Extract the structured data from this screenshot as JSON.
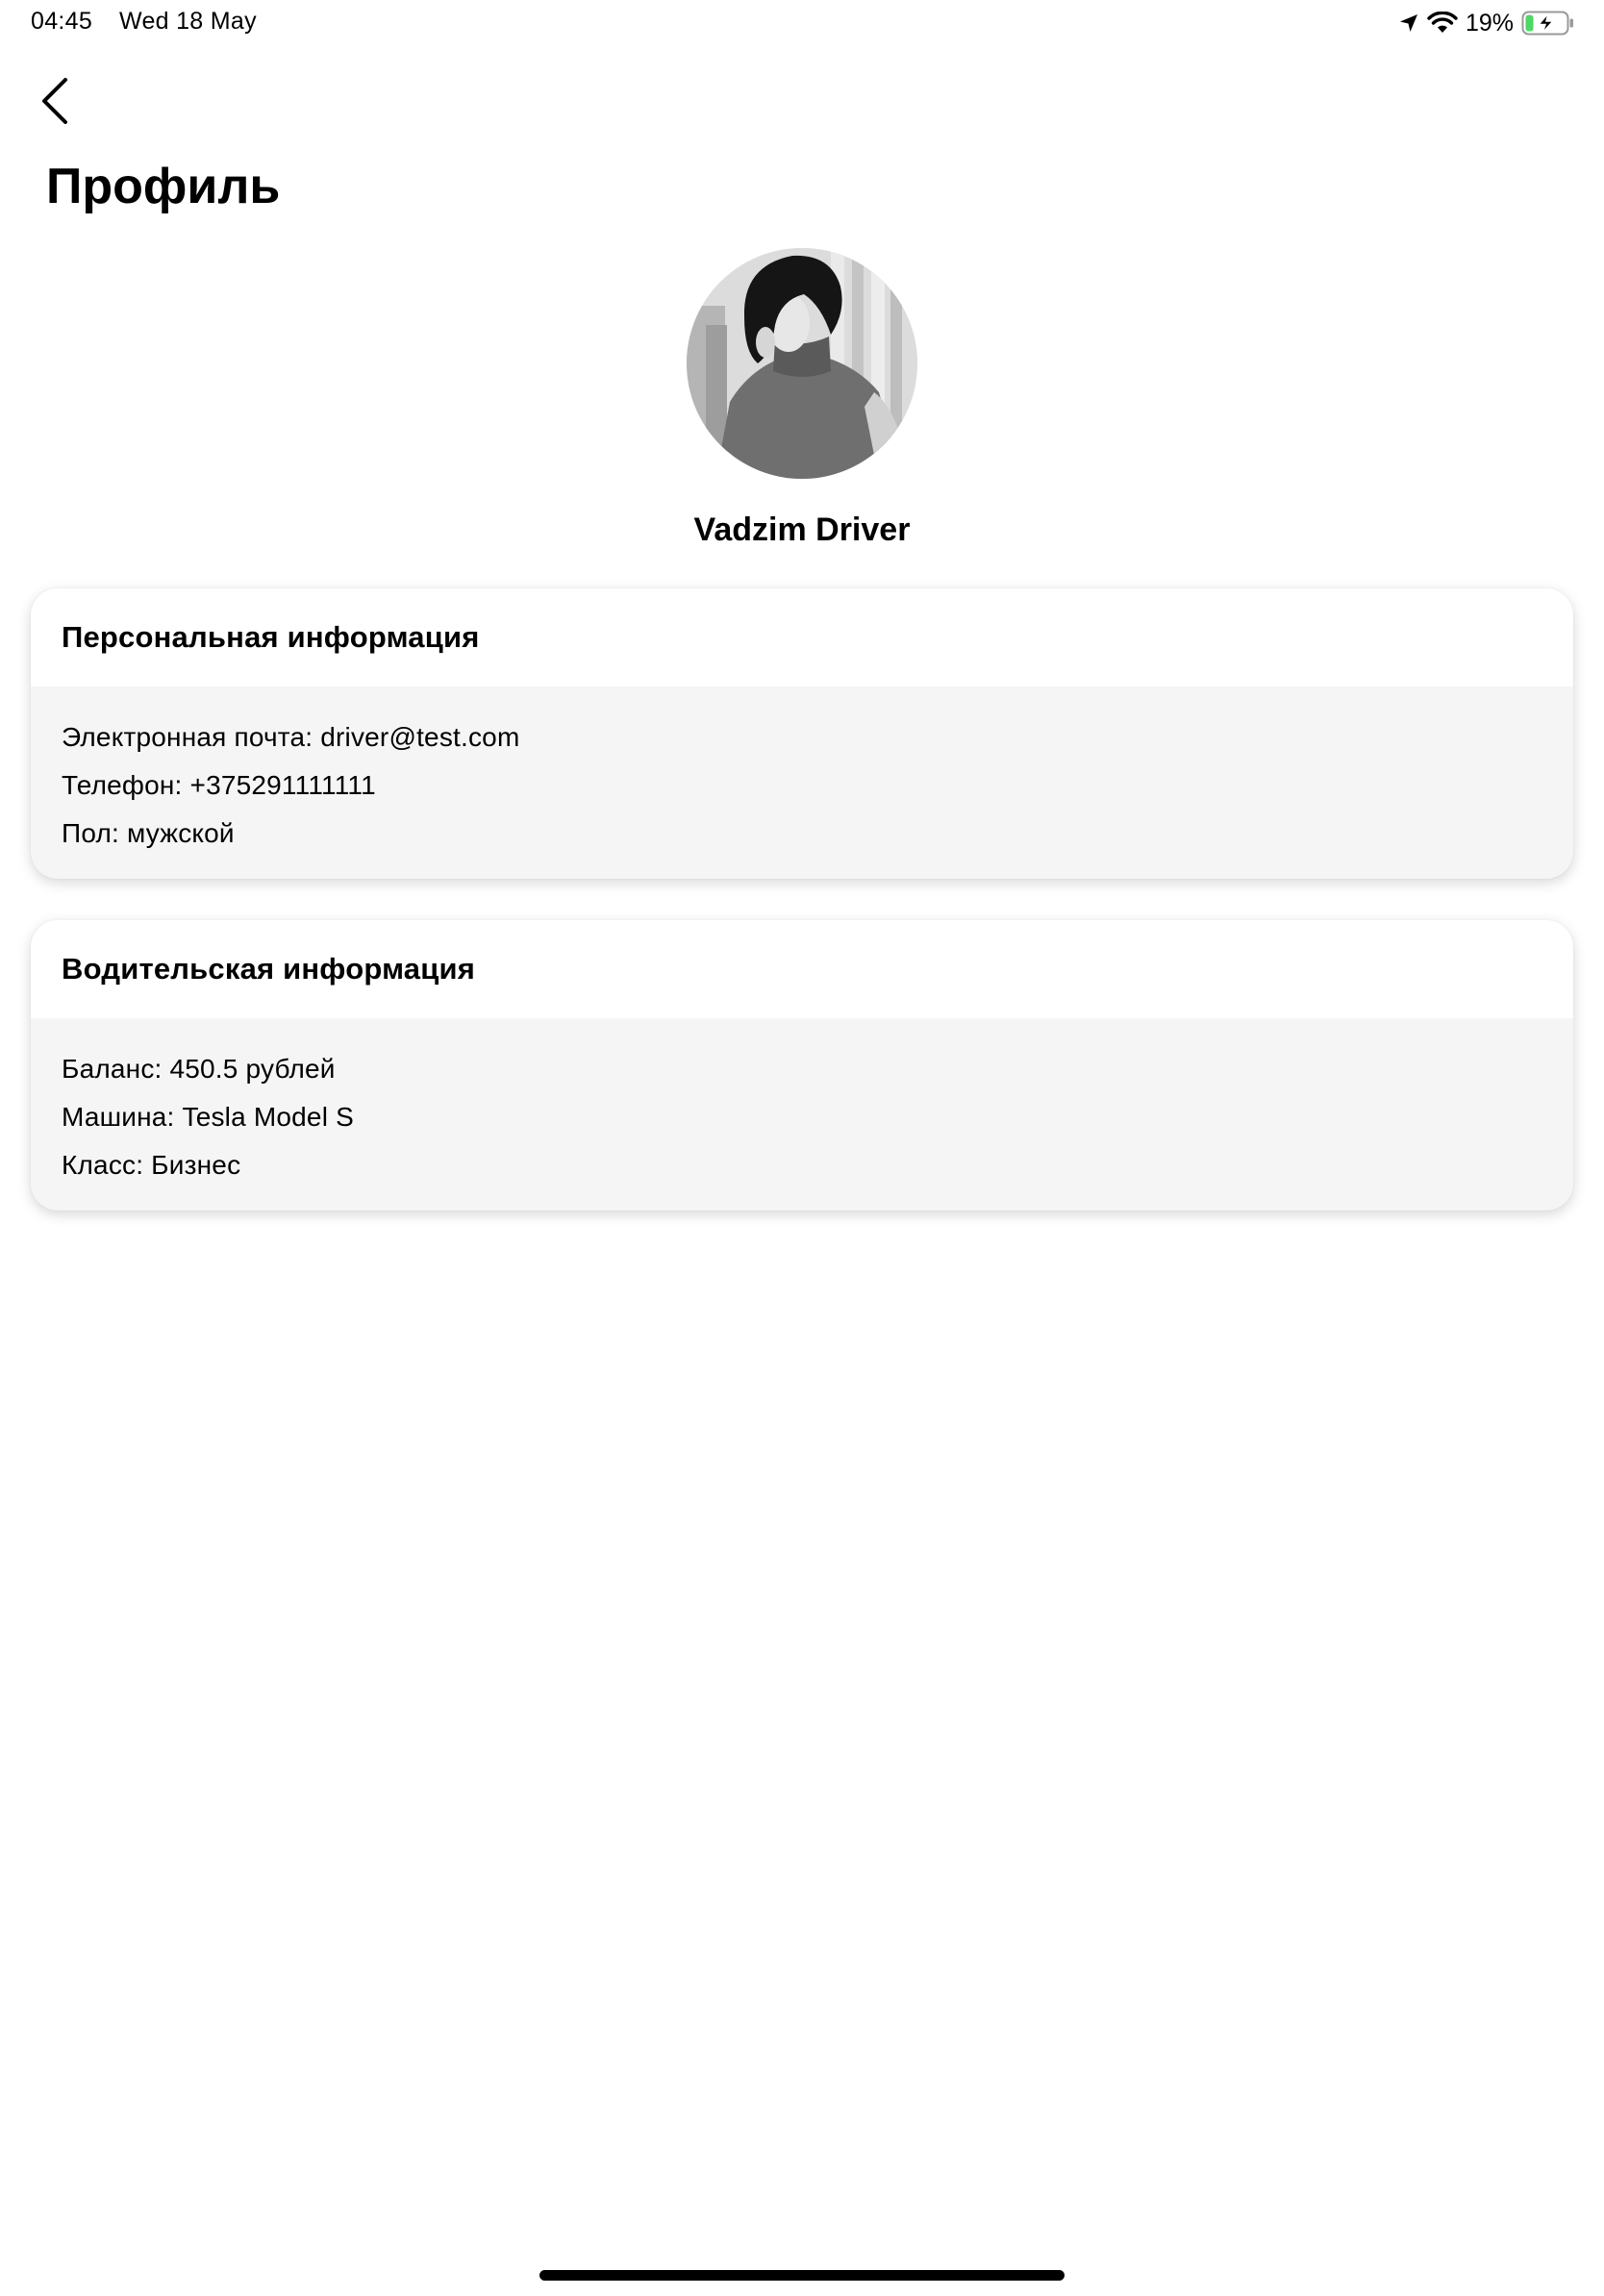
{
  "status_bar": {
    "time": "04:45",
    "date": "Wed 18 May",
    "battery_percent": "19%",
    "battery_level": 0.19,
    "icons": [
      "location-arrow-icon",
      "wifi-icon",
      "battery-charging-icon"
    ]
  },
  "header": {
    "back_icon": "chevron-left-icon",
    "title": "Профиль"
  },
  "profile": {
    "name": "Vadzim Driver"
  },
  "personal_info": {
    "title": "Персональная информация",
    "rows": [
      "Электронная почта: driver@test.com",
      "Телефон: +375291111111",
      "Пол: мужской"
    ]
  },
  "driver_info": {
    "title": "Водительская информация",
    "rows": [
      "Баланс: 450.5 рублей",
      "Машина: Tesla Model S",
      "Класс: Бизнес"
    ]
  },
  "colors": {
    "background": "#ffffff",
    "card_body": "#f5f5f5",
    "text": "#000000",
    "battery_fill": "#4cd964"
  }
}
